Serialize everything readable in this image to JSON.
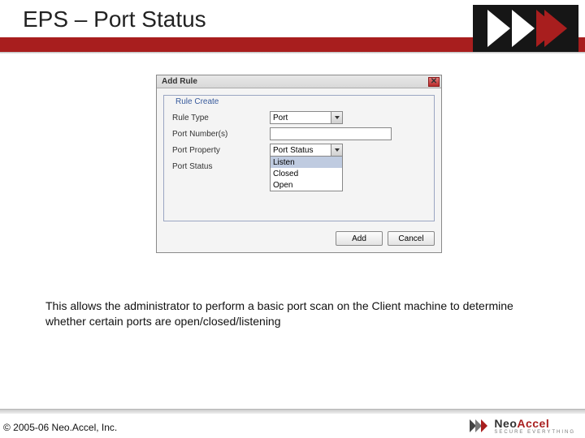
{
  "slide": {
    "title": "EPS – Port Status",
    "caption": "This allows the administrator to perform a basic port scan on the Client machine to determine whether certain ports are open/closed/listening",
    "copyright": "© 2005-06 Neo.Accel, Inc."
  },
  "dialog": {
    "title": "Add Rule",
    "legend": "Rule Create",
    "fields": {
      "rule_type": {
        "label": "Rule Type",
        "value": "Port"
      },
      "port_numbers": {
        "label": "Port Number(s)",
        "value": ""
      },
      "port_property": {
        "label": "Port Property",
        "value": "Port Status"
      },
      "port_status": {
        "label": "Port Status",
        "value": "Listen"
      }
    },
    "status_options": [
      "Listen",
      "Closed",
      "Open"
    ],
    "buttons": {
      "add": "Add",
      "cancel": "Cancel"
    }
  },
  "logo": {
    "brand1": "Neo",
    "brand2": "Accel",
    "tagline": "SECURE EVERYTHING"
  }
}
